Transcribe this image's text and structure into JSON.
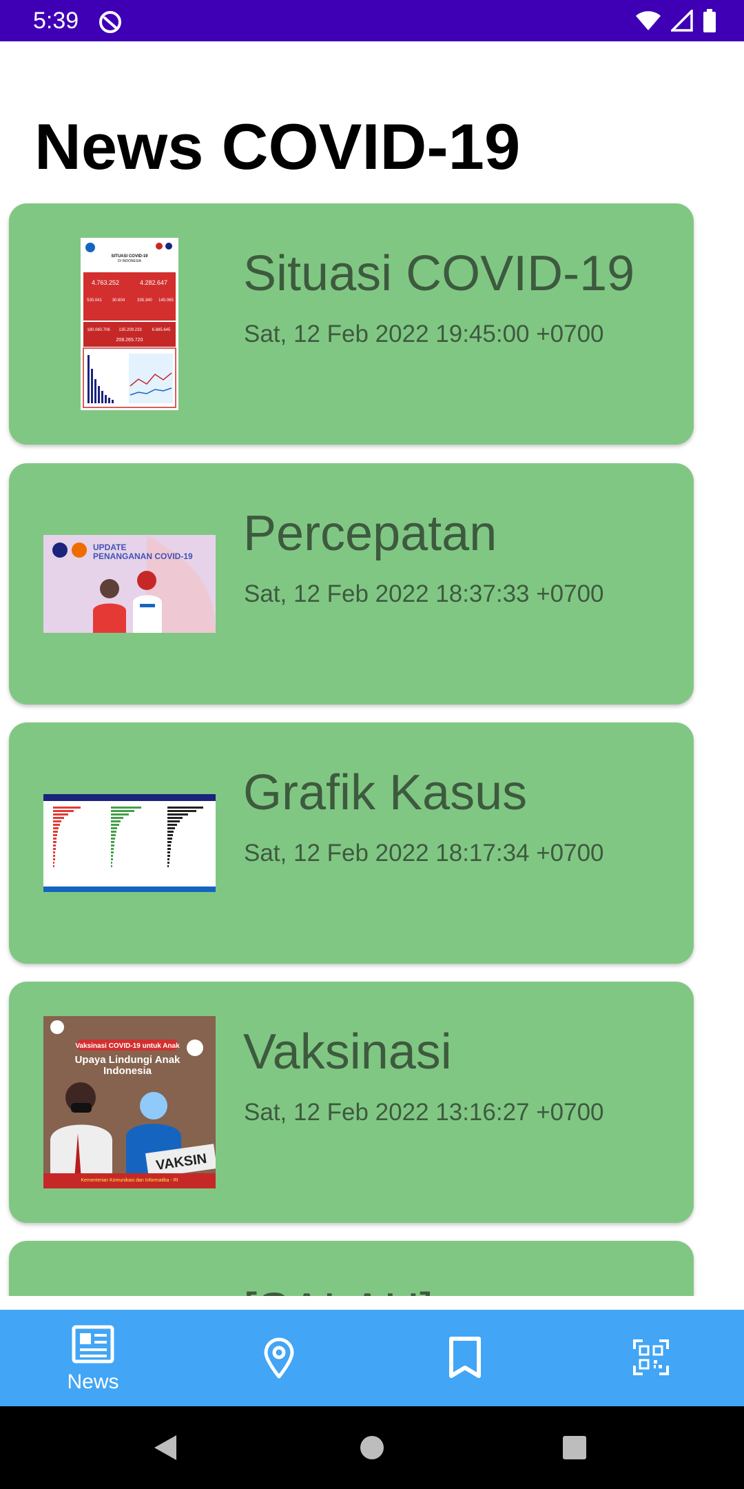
{
  "status_bar": {
    "time": "5:39",
    "icons": [
      "app-notification-icon",
      "wifi-icon",
      "signal-icon",
      "battery-icon"
    ],
    "background": "#3f00b5"
  },
  "page": {
    "title": "News COVID-19"
  },
  "news": [
    {
      "title": "Situasi COVID-19",
      "date": "Sat, 12 Feb 2022 19:45:00 +0700",
      "thumbnail": "situasi-infographic-image"
    },
    {
      "title": "Percepatan",
      "date": "Sat, 12 Feb 2022 18:37:33 +0700",
      "thumbnail": "update-penanganan-image",
      "thumb_text": [
        "UPDATE",
        "PENANGANAN COVID-19"
      ]
    },
    {
      "title": "Grafik Kasus",
      "date": "Sat, 12 Feb 2022 18:17:34 +0700",
      "thumbnail": "grafik-kasus-chart-image"
    },
    {
      "title": "Vaksinasi",
      "date": "Sat, 12 Feb 2022 13:16:27 +0700",
      "thumbnail": "vaksinasi-photo-image",
      "thumb_text": [
        "Vaksinasi COVID-19 untuk Anak",
        "Upaya Lindungi Anak",
        "Indonesia",
        "VAKSIN",
        "Kementerian Komunikasi dan Informatika - RI"
      ]
    },
    {
      "title": "[SALAH]",
      "date": "",
      "thumbnail": ""
    }
  ],
  "situasi_thumb_text": [
    "SITUASI COVID-19",
    "DI INDONESIA",
    "4.763.252",
    "4.282.647",
    "530.041",
    "30.604",
    "335.340",
    "145.065",
    "180.060.706",
    "135.209.233",
    "6.885.645",
    "208.265.720"
  ],
  "bottom_nav": {
    "items": [
      {
        "label": "News",
        "icon": "news-icon",
        "active": true
      },
      {
        "label": "",
        "icon": "location-pin-icon",
        "active": false
      },
      {
        "label": "",
        "icon": "bookmark-icon",
        "active": false
      },
      {
        "label": "",
        "icon": "qr-code-icon",
        "active": false
      }
    ],
    "background": "#42a5f5"
  },
  "colors": {
    "card": "#81c784",
    "card_text": "#3d5a3e",
    "title": "#000000"
  }
}
